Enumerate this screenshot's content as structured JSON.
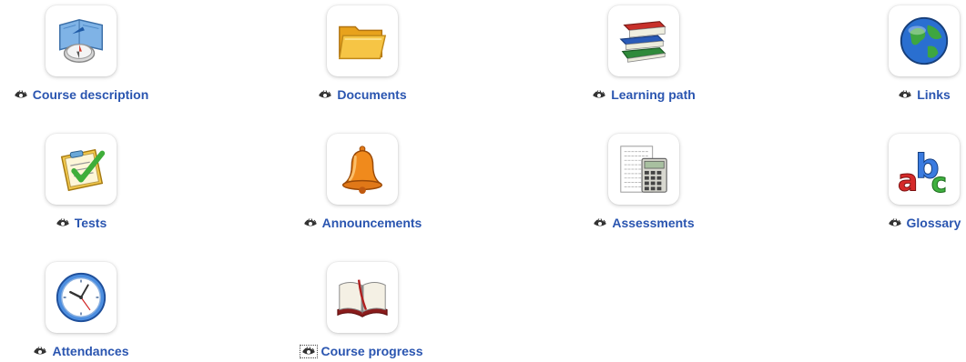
{
  "tools": [
    {
      "label": "Course description",
      "icon": "course-description-icon"
    },
    {
      "label": "Documents",
      "icon": "folder-icon"
    },
    {
      "label": "Learning path",
      "icon": "books-icon"
    },
    {
      "label": "Links",
      "icon": "globe-icon"
    },
    {
      "label": "Tests",
      "icon": "quiz-checklist-icon"
    },
    {
      "label": "Announcements",
      "icon": "bell-icon"
    },
    {
      "label": "Assessments",
      "icon": "calculator-sheet-icon"
    },
    {
      "label": "Glossary",
      "icon": "abc-letters-icon"
    },
    {
      "label": "Attendances",
      "icon": "clock-icon"
    },
    {
      "label": "Course progress",
      "icon": "open-book-icon"
    }
  ],
  "visibility_icon": "eye-visible-icon",
  "colors": {
    "link": "#2a55b0",
    "tile_bg": "#ffffff"
  }
}
